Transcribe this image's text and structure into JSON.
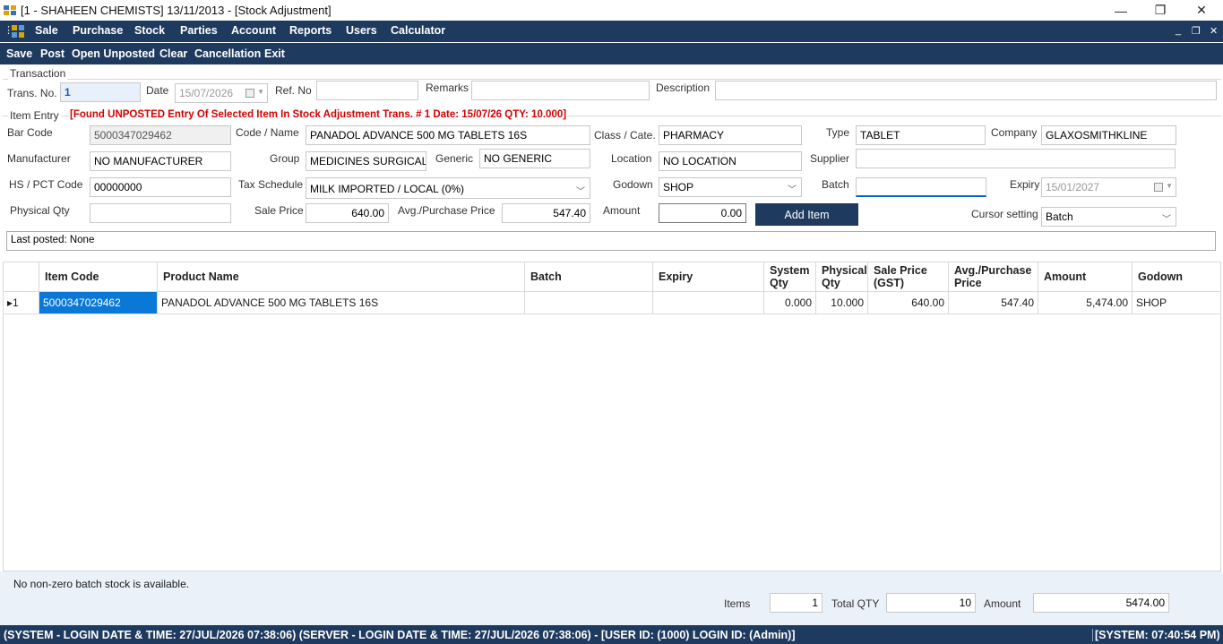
{
  "window": {
    "title": "[1 - SHAHEEN CHEMISTS] 13/11/2013 - [Stock Adjustment]",
    "minimize": "—",
    "maximize": "❐",
    "close": "✕"
  },
  "menu": {
    "items": [
      "Sale",
      "Purchase",
      "Stock",
      "Parties",
      "Account",
      "Reports",
      "Users",
      "Calculator"
    ],
    "mdi": {
      "minimize": "_",
      "restore": "❐",
      "close": "✕"
    }
  },
  "toolbar": {
    "items": [
      "Save",
      "Post",
      "Open Unposted",
      "Clear",
      "Cancellation",
      "Exit"
    ]
  },
  "transaction": {
    "group_label": "Transaction",
    "trans_no_label": "Trans. No.",
    "trans_no": "1",
    "date_label": "Date",
    "date": "15/07/2026",
    "refno_label": "Ref. No",
    "refno": "",
    "remarks_label": "Remarks",
    "remarks": "",
    "description_label": "Description",
    "description": ""
  },
  "item_entry": {
    "group_label": "Item Entry",
    "warning": "[Found UNPOSTED Entry Of Selected Item In Stock Adjustment Trans. # 1 Date: 15/07/26 QTY: 10.000]",
    "barcode_label": "Bar Code",
    "barcode": "5000347029462",
    "code_name_label": "Code / Name",
    "code_name": "PANADOL ADVANCE 500 MG TABLETS 16S",
    "class_label": "Class / Cate.",
    "class": "PHARMACY",
    "type_label": "Type",
    "type": "TABLET",
    "company_label": "Company",
    "company": "GLAXOSMITHKLINE",
    "manufacturer_label": "Manufacturer",
    "manufacturer": "NO MANUFACTURER",
    "group_label2": "Group",
    "group": "MEDICINES SURGICALS",
    "generic_label": "Generic",
    "generic": "NO GENERIC",
    "location_label": "Location",
    "location": "NO LOCATION",
    "supplier_label": "Supplier",
    "supplier": "",
    "hs_label": "HS / PCT Code",
    "hs": "00000000",
    "tax_label": "Tax Schedule",
    "tax": "MILK IMPORTED / LOCAL (0%)",
    "godown_label": "Godown",
    "godown": "SHOP",
    "batch_label": "Batch",
    "batch": "",
    "expiry_label": "Expiry",
    "expiry": "15/01/2027",
    "physical_qty_label": "Physical Qty",
    "physical_qty": "",
    "sale_price_label": "Sale Price",
    "sale_price": "640.00",
    "avg_price_label": "Avg./Purchase Price",
    "avg_price": "547.40",
    "amount_label": "Amount",
    "amount": "0.00",
    "add_item": "Add Item",
    "cursor_label": "Cursor setting",
    "cursor": "Batch",
    "last_posted": "Last posted: None"
  },
  "grid": {
    "columns": [
      "Item Code",
      "Product Name",
      "Batch",
      "Expiry",
      "System Qty",
      "Physical Qty",
      "Sale Price (GST)",
      "Avg./Purchase Price",
      "Amount",
      "Godown"
    ],
    "rows": [
      {
        "indicator": "▸1",
        "item_code": "5000347029462",
        "product_name": "PANADOL ADVANCE 500 MG TABLETS 16S",
        "batch": "",
        "expiry": "",
        "system_qty": "0.000",
        "physical_qty": "10.000",
        "sale_price": "640.00",
        "avg_price": "547.40",
        "amount": "5,474.00",
        "godown": "SHOP"
      }
    ]
  },
  "footer": {
    "message": "No non-zero batch stock is available.",
    "items_label": "Items",
    "items": "1",
    "total_qty_label": "Total QTY",
    "total_qty": "10",
    "amount_label": "Amount",
    "amount": "5474.00"
  },
  "status": {
    "left": "(SYSTEM - LOGIN DATE & TIME: 27/JUL/2026 07:38:06) (SERVER - LOGIN DATE & TIME: 27/JUL/2026 07:38:06) -  [USER ID: (1000)  LOGIN ID: (Admin)]",
    "right": "[SYSTEM: 07:40:54 PM)"
  },
  "colors": {
    "menubar": "#1f3a5f",
    "warning": "#d40000",
    "selection": "#0a78d7"
  }
}
